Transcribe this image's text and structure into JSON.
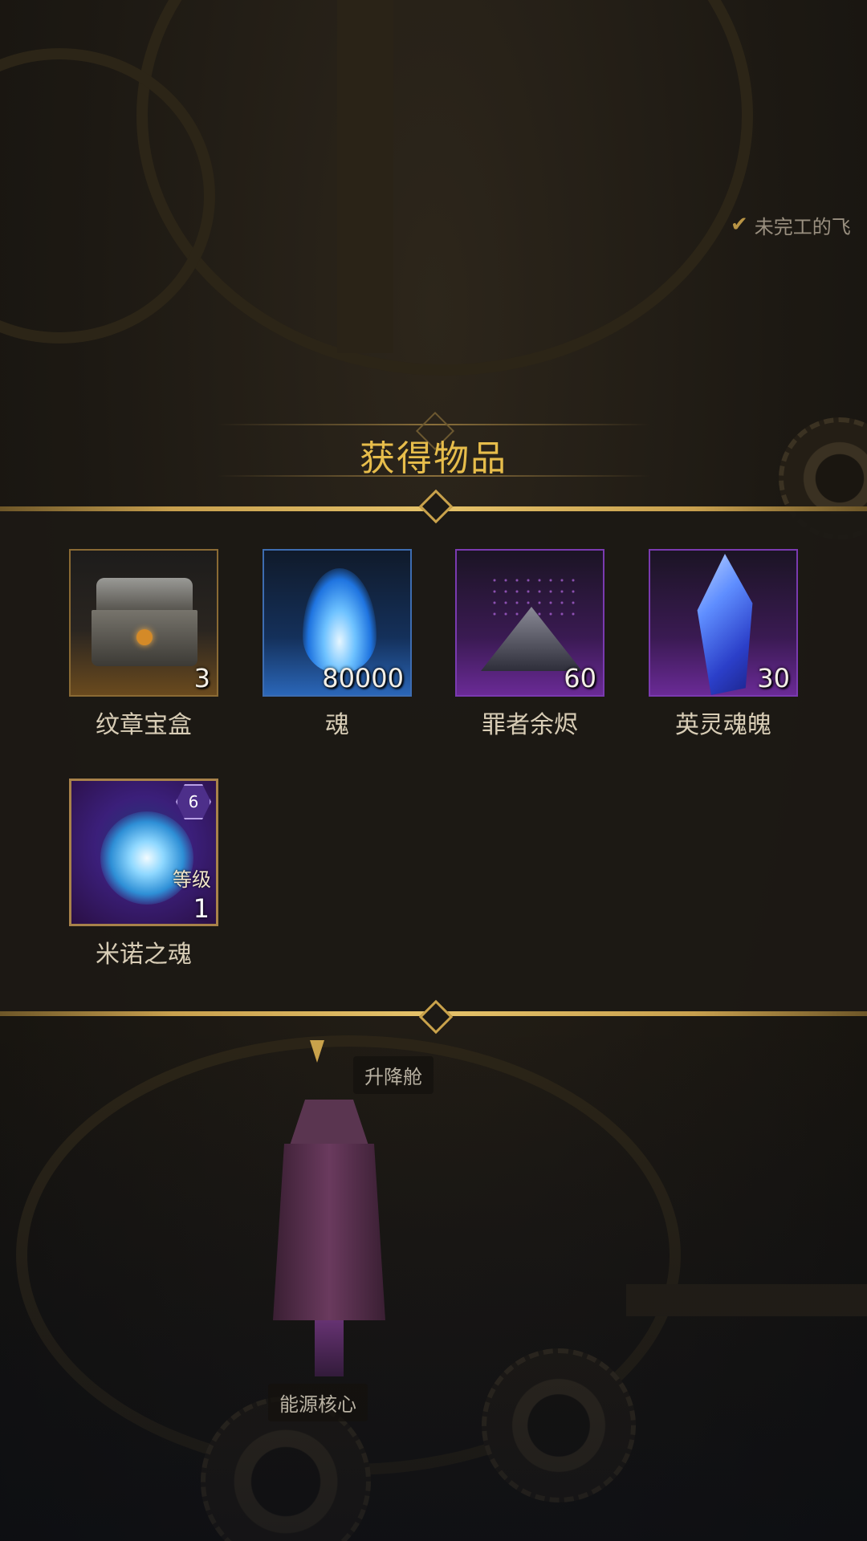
{
  "quest": {
    "label": "未完工的飞"
  },
  "dialog": {
    "title": "获得物品"
  },
  "items": [
    {
      "name": "纹章宝盒",
      "count": "3",
      "icon": "treasure-chest-icon",
      "quality": "orange"
    },
    {
      "name": "魂",
      "count": "80000",
      "icon": "blue-flame-icon",
      "quality": "blue"
    },
    {
      "name": "罪者余烬",
      "count": "60",
      "icon": "ember-pile-icon",
      "quality": "purple"
    },
    {
      "name": "英灵魂魄",
      "count": "30",
      "icon": "crystal-icon",
      "quality": "purple"
    },
    {
      "name": "米诺之魂",
      "badge": "6",
      "level_label": "等级",
      "level": "1",
      "icon": "soul-orb-icon",
      "quality": "purple"
    }
  ],
  "map_labels": {
    "elevator": "升降舱",
    "core": "能源核心"
  },
  "colors": {
    "title": "#e7bd4b",
    "border_gold": "#c8a04e",
    "panel_bg": "#1c1915"
  }
}
